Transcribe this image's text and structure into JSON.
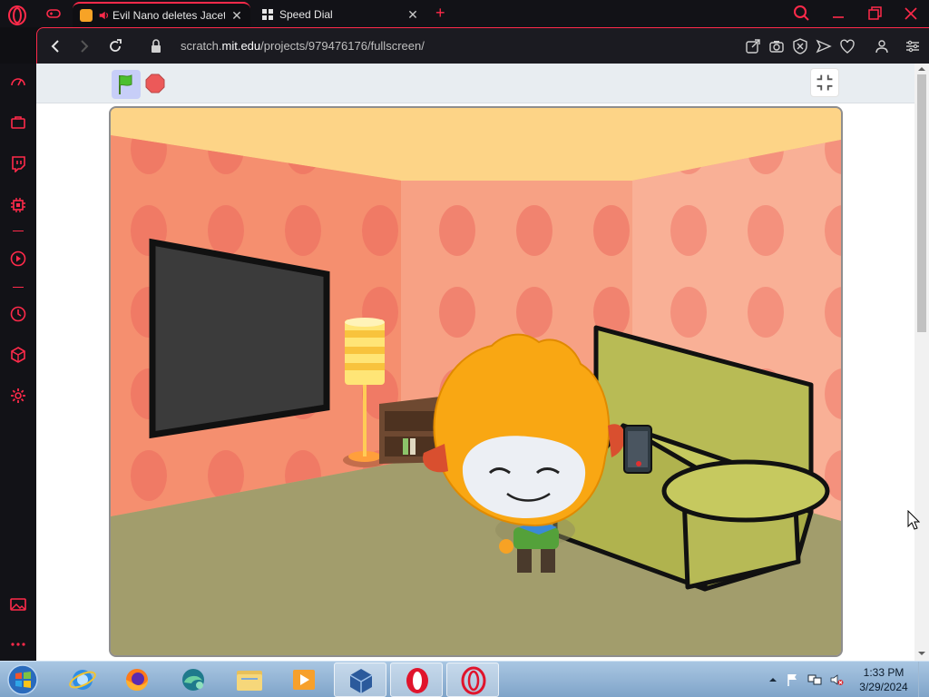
{
  "browser": {
    "tabs": [
      {
        "label": "Evil Nano deletes Jacetl",
        "active": true,
        "favicon": "scratch-favicon",
        "audio_icon": "speaker-icon"
      },
      {
        "label": "Speed Dial",
        "active": false,
        "favicon": "speed-dial-icon"
      }
    ],
    "url": {
      "prefix": "scratch.",
      "domain": "mit.edu",
      "path": "/projects/979476176/fullscreen/"
    },
    "accent_color": "#ff2a4a"
  },
  "scratch": {
    "controls": [
      "green-flag",
      "stop-sign",
      "exit-fullscreen"
    ],
    "stage": {
      "scene": "living room",
      "elements": [
        "tv",
        "floor-lamp",
        "bookshelf",
        "green-couch",
        "orange-character-with-phone"
      ]
    }
  },
  "taskbar": {
    "apps": [
      "internet-explorer",
      "firefox",
      "edge-beta",
      "file-explorer",
      "media-player",
      "virtualbox",
      "opera",
      "opera-gx"
    ],
    "clock": {
      "time": "1:33 PM",
      "date": "3/29/2024"
    }
  }
}
